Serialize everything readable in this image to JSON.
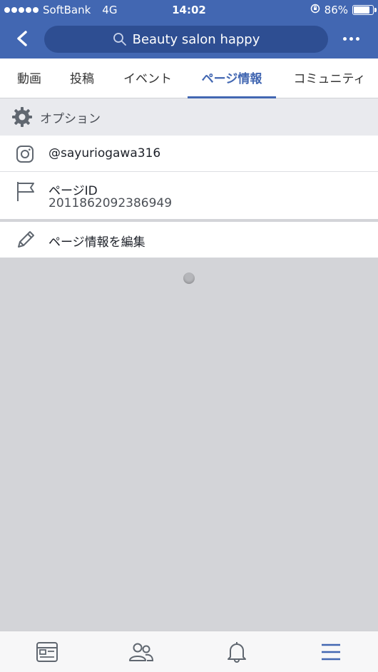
{
  "status_bar": {
    "carrier": "SoftBank",
    "network": "4G",
    "time": "14:02",
    "battery": "86%",
    "battery_level": 0.86
  },
  "header": {
    "search_text": "Beauty salon happy",
    "back_icon": "chevron-left-icon",
    "more_icon": "more-dots-icon"
  },
  "tabs": [
    {
      "label": "動画"
    },
    {
      "label": "投稿"
    },
    {
      "label": "イベント"
    },
    {
      "label": "ページ情報",
      "active": true
    },
    {
      "label": "コミュニティ"
    }
  ],
  "options_section": {
    "label": "オプション"
  },
  "rows": {
    "instagram": {
      "label": "@sayuriogawa316"
    },
    "page_id": {
      "label": "ページID",
      "value": "2011862092386949"
    },
    "edit": {
      "label": "ページ情報を編集"
    }
  },
  "bottom_nav": [
    {
      "icon": "news-feed-icon"
    },
    {
      "icon": "friends-icon"
    },
    {
      "icon": "notifications-bell-icon"
    },
    {
      "icon": "menu-icon",
      "active": true
    }
  ],
  "colors": {
    "brand": "#4267b2",
    "search_bg": "#2e4e92",
    "content_bg": "#d3d4d8",
    "active_tab": "#4267b2"
  }
}
